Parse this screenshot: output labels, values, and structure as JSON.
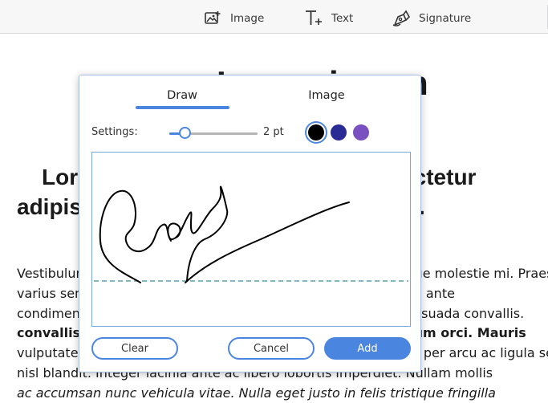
{
  "toolbar": {
    "items": [
      {
        "label": "Image",
        "icon": "image-add-icon"
      },
      {
        "label": "Text",
        "icon": "text-add-icon"
      },
      {
        "label": "Signature",
        "icon": "pen-nib-icon"
      }
    ]
  },
  "document": {
    "title": "Lorem ipsum",
    "subtitle": "Lorem ipsum dolor sit amet, consectetur adipiscing elit. Nunc ac faucibus odio.",
    "body_lines": [
      [
        "Vestibulum neque massa, scelerisque sit amet ligula eu, congue molestie mi. Praesent",
        "normal"
      ],
      [
        "varius sem a erat feugiat, quis dictum massa. Ut ac dolor vitae ante",
        "normal"
      ],
      [
        "condimentum lacinia. Mauris quis sem dignissim mi vitae malesuada convallis.",
        "mixed"
      ],
      [
        "convallis nulla, vitae eleifend augue hendrerit fermentum orci. Mauris",
        "mixed"
      ],
      [
        "vulputate massa augue, sed euismod neque semper sit. Etiam per arcu ac ligula sed",
        "normal"
      ],
      [
        "nisl blandit. Integer lacinia ante ac libero lobortis imperdiet. Nullam mollis",
        "mixed"
      ],
      [
        "ac accumsan nunc vehicula vitae. Nulla eget justo in felis tristique fringilla",
        "mixed"
      ]
    ]
  },
  "dialog": {
    "tabs": [
      {
        "label": "Draw",
        "active": true
      },
      {
        "label": "Image",
        "active": false
      }
    ],
    "settings_label": "Settings:",
    "stroke_width": 2,
    "stroke_width_label": "2 pt",
    "slider_fraction": 0.18,
    "colors": [
      {
        "hex": "#000000",
        "selected": true
      },
      {
        "hex": "#2b2b96",
        "selected": false
      },
      {
        "hex": "#7a4fc0",
        "selected": false
      }
    ],
    "buttons": {
      "clear": "Clear",
      "cancel": "Cancel",
      "add": "Add"
    }
  },
  "colors": {
    "accent": "#4a86e0",
    "baseline": "#3d8c9a"
  }
}
